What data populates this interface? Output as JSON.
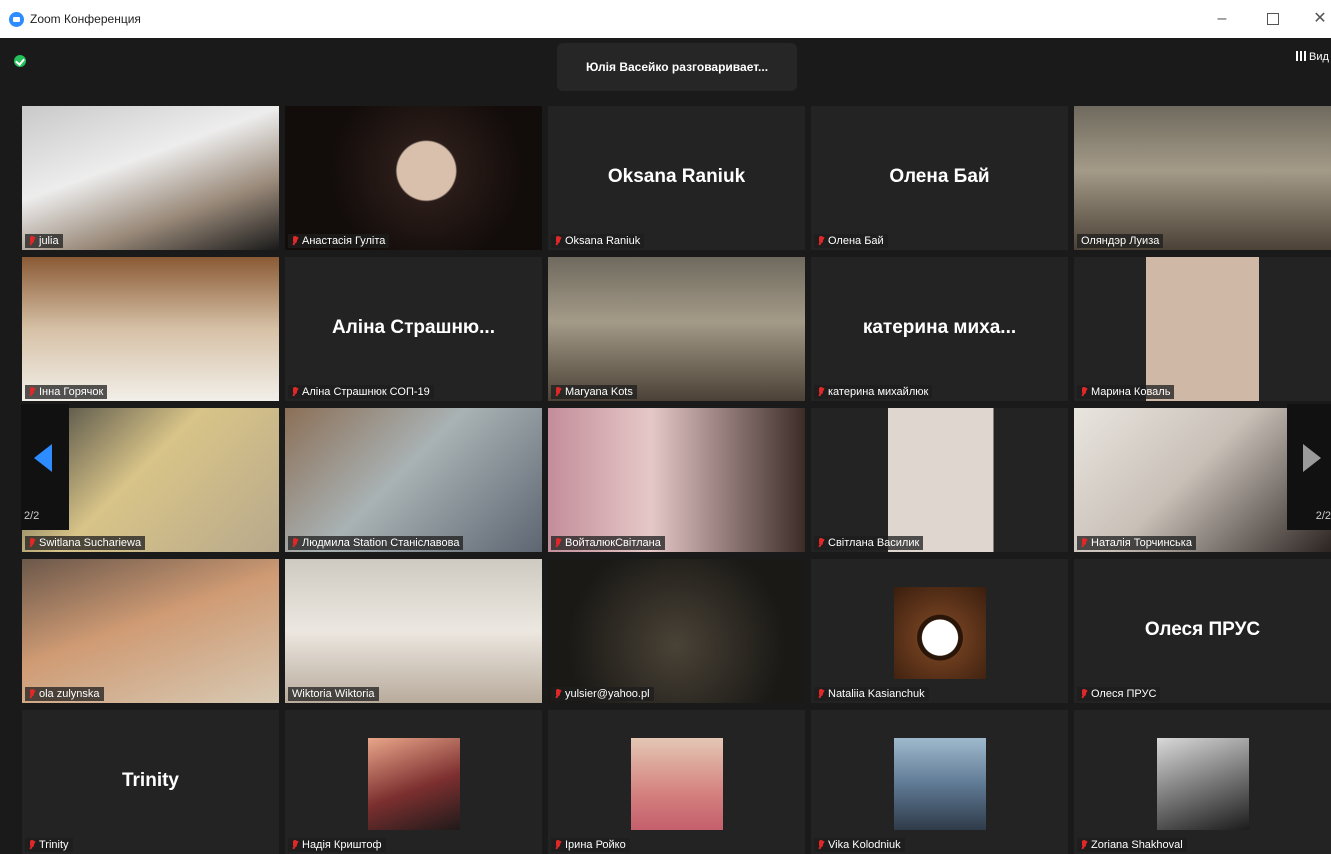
{
  "window": {
    "title": "Zoom Конференция",
    "minimize": "–",
    "close": "✕"
  },
  "topbar": {
    "speaker": "Юлія Васейко разговаривает...",
    "view": "Вид"
  },
  "pager": {
    "left_page": "2/2",
    "right_page": "2/2"
  },
  "tiles": [
    {
      "label": "julia",
      "big": "",
      "muted": true
    },
    {
      "label": "Анастасія Гуліта",
      "big": "",
      "muted": true
    },
    {
      "label": "Oksana Raniuk",
      "big": "Oksana Raniuk",
      "muted": true
    },
    {
      "label": "Олена Бай",
      "big": "Олена Бай",
      "muted": true
    },
    {
      "label": "Оляндэр Луиза",
      "big": "",
      "muted": false
    },
    {
      "label": "Інна Горячок",
      "big": "",
      "muted": true
    },
    {
      "label": "Аліна Страшнюк СОП-19",
      "big": "Аліна Страшню...",
      "muted": true
    },
    {
      "label": "Maryana Kots",
      "big": "",
      "muted": true
    },
    {
      "label": "катерина михайлюк",
      "big": "катерина миха...",
      "muted": true
    },
    {
      "label": "Марина Коваль",
      "big": "",
      "muted": true
    },
    {
      "label": "Switlana Suchariewa",
      "big": "",
      "muted": true
    },
    {
      "label": "Людмила Station Станіславова",
      "big": "",
      "muted": true
    },
    {
      "label": "ВойталюкСвітлана",
      "big": "",
      "muted": true
    },
    {
      "label": "Світлана Василик",
      "big": "",
      "muted": true
    },
    {
      "label": "Наталія Торчинська",
      "big": "",
      "muted": true
    },
    {
      "label": "ola zulynska",
      "big": "",
      "muted": true
    },
    {
      "label": "Wiktoria Wiktoria",
      "big": "",
      "muted": false
    },
    {
      "label": "yulsier@yahoo.pl",
      "big": "",
      "muted": true
    },
    {
      "label": "Nataliia Kasianchuk",
      "big": "",
      "muted": true
    },
    {
      "label": "Олеся ПРУС",
      "big": "Олеся ПРУС",
      "muted": true
    },
    {
      "label": "Trinity",
      "big": "Trinity",
      "muted": true
    },
    {
      "label": "Надія Криштоф",
      "big": "",
      "muted": true
    },
    {
      "label": "Ірина Ройко",
      "big": "",
      "muted": true
    },
    {
      "label": "Vika Kolodniuk",
      "big": "",
      "muted": true
    },
    {
      "label": "Zoriana Shakhoval",
      "big": "",
      "muted": true
    }
  ]
}
